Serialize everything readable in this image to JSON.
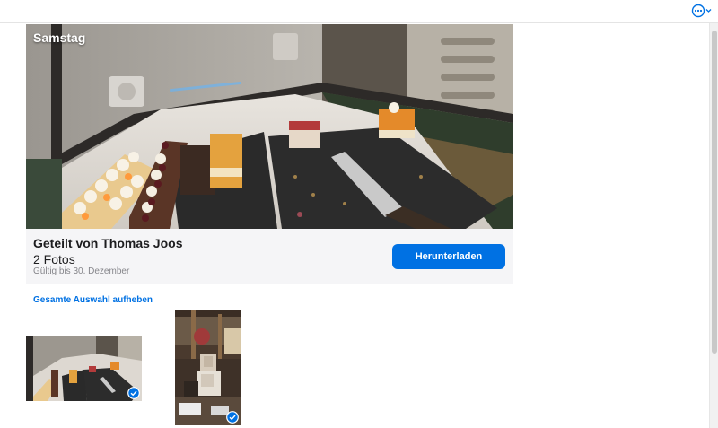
{
  "header": {
    "menu_icon": "ellipsis-circle-icon",
    "chevron_icon": "chevron-down-icon"
  },
  "hero": {
    "title": "Samstag"
  },
  "share": {
    "shared_by": "Geteilt von Thomas Joos",
    "photo_count": "2 Fotos",
    "valid_until": "Gültig bis 30. Dezember",
    "download_label": "Herunterladen"
  },
  "selection": {
    "deselect_all_label": "Gesamte Auswahl aufheben"
  },
  "photos": [
    {
      "selected": true,
      "icon": "checkmark-circle-icon"
    },
    {
      "selected": true,
      "icon": "checkmark-circle-icon"
    }
  ],
  "colors": {
    "accent": "#0071e3",
    "info_bg": "#f5f5f7"
  }
}
